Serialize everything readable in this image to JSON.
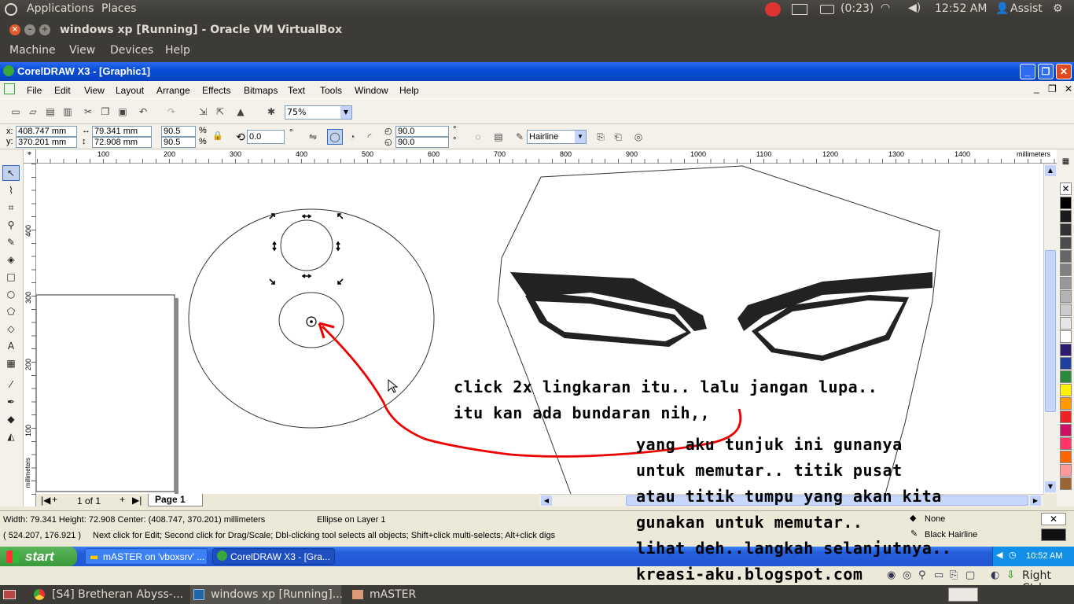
{
  "gnome_top": {
    "applications": "Applications",
    "places": "Places",
    "battery": "(0:23)",
    "time": "12:52 AM",
    "user": "Assist"
  },
  "vbox": {
    "title": "windows xp [Running] - Oracle VM VirtualBox",
    "menu": [
      "Machine",
      "View",
      "Devices",
      "Help"
    ],
    "host_key": "Right Ctrl"
  },
  "coreldraw": {
    "title": "CorelDRAW X3 - [Graphic1]",
    "menu": [
      "File",
      "Edit",
      "View",
      "Layout",
      "Arrange",
      "Effects",
      "Bitmaps",
      "Text",
      "Tools",
      "Window",
      "Help"
    ],
    "zoom": "75%",
    "props": {
      "x": "408.747 mm",
      "y": "370.201 mm",
      "w": "79.341 mm",
      "h": "72.908 mm",
      "scale_x": "90.5",
      "scale_y": "90.5",
      "pct": "%",
      "rotation": "0.0",
      "deg": "°",
      "angle1": "90.0",
      "angle2": "90.0",
      "outline": "Hairline"
    },
    "ruler_units": "millimeters",
    "ruler_h": [
      "100",
      "200",
      "300",
      "400",
      "500",
      "600",
      "700",
      "800",
      "900",
      "1000",
      "1100",
      "1200",
      "1300",
      "1400"
    ],
    "ruler_v": [
      "400",
      "300",
      "200",
      "100"
    ],
    "ruler_v_unit": "millimeters",
    "page_counter": "1 of 1",
    "page_tab": "Page 1",
    "status": {
      "dims": "Width: 79.341  Height: 72.908  Center: (408.747, 370.201)  millimeters",
      "object": "Ellipse on Layer 1",
      "cursor": "( 524.207, 176.921 )",
      "hint": "Next click for Edit; Second click for Drag/Scale; Dbl-clicking tool selects all objects; Shift+click multi-selects; Alt+click digs",
      "fill": "None",
      "outline": "Black  Hairline"
    },
    "palette": [
      "#000000",
      "#1a1a1a",
      "#333333",
      "#4d4d4d",
      "#666666",
      "#808080",
      "#999999",
      "#b3b3b3",
      "#cccccc",
      "#e6e6e6",
      "#ffffff",
      "#2e1a6e",
      "#1f3fa0",
      "#2a8a3a",
      "#fff200",
      "#ff9900",
      "#ee2222",
      "#cc1166",
      "#ff3366",
      "#ff6600",
      "#ff9999",
      "#996633"
    ]
  },
  "xp_taskbar": {
    "start": "start",
    "tasks": [
      "mASTER on 'vboxsrv' ...",
      "CorelDRAW X3 - [Gra..."
    ],
    "clock": "10:52 AM"
  },
  "gnome_bottom": {
    "tasks": [
      "[S4] Bretheran Abyss-...",
      "windows xp [Running]...",
      "mASTER"
    ]
  },
  "annotation": {
    "line1": "click 2x lingkaran itu.. lalu jangan lupa..",
    "line2": "itu kan ada bundaran nih,,",
    "line3": "yang aku tunjuk ini gunanya",
    "line4": "untuk memutar.. titik pusat",
    "line5": "atau titik tumpu yang akan kita",
    "line6": "gunakan untuk memutar..",
    "line7": "lihat deh..langkah selanjutnya..",
    "line8": "kreasi-aku.blogspot.com"
  }
}
